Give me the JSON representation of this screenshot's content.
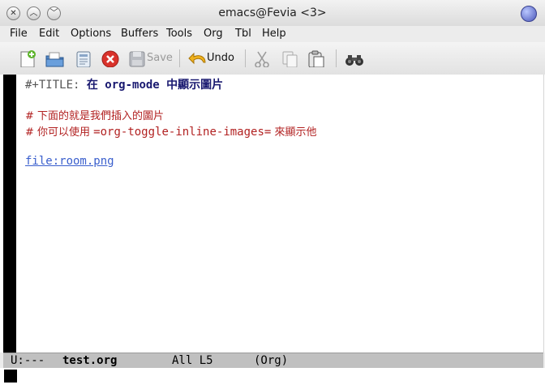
{
  "window": {
    "title": "emacs@Fevia <3>"
  },
  "menubar": {
    "items": [
      "File",
      "Edit",
      "Options",
      "Buffers",
      "Tools",
      "Org",
      "Tbl",
      "Help"
    ]
  },
  "toolbar": {
    "save_label": "Save",
    "undo_label": "Undo"
  },
  "buffer": {
    "title_keyword": "#+TITLE: ",
    "title_cjk1": "在 ",
    "title_mid": "org-mode",
    "title_cjk2": " 中顯示圖片",
    "comment1": "# 下面的就是我們插入的圖片",
    "comment2_prefix": "# 你可以使用 ",
    "comment2_code": "=org-toggle-inline-images=",
    "comment2_suffix": " 來顯示他",
    "link": "file:room.png"
  },
  "modeline": {
    "status": "U:---",
    "buffer_name": "test.org",
    "position": "All L5",
    "mode": "(Org)"
  },
  "colors": {
    "comment": "#b22222",
    "link": "#3a5fcd",
    "title": "#191970",
    "keyword": "#555555"
  }
}
